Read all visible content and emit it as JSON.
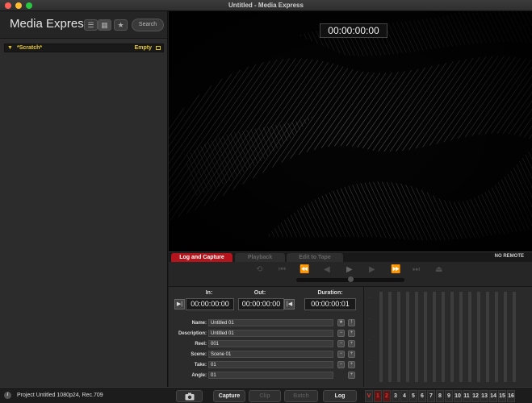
{
  "window": {
    "title": "Untitled - Media Express",
    "light_colors": [
      "#fe5f57",
      "#febc2e",
      "#28c840"
    ]
  },
  "sidebar": {
    "app_title": "Media Express",
    "list_view_icon": "list-icon",
    "thumbnail_view_icon": "grid-icon",
    "favorites_icon": "star-icon",
    "search_label": "Search",
    "bin": {
      "name": "*Scratch*",
      "status": "Empty"
    }
  },
  "viewer": {
    "timecode": "00:00:00:00"
  },
  "tabs": [
    {
      "label": "Log and Capture",
      "active": true
    },
    {
      "label": "Playback",
      "active": false
    },
    {
      "label": "Edit to Tape",
      "active": false
    }
  ],
  "remote_status": "NO REMOTE",
  "log": {
    "in_label": "In:",
    "out_label": "Out:",
    "duration_label": "Duration:",
    "in_tc": "00:00:00:00",
    "out_tc": "00:00:00:00",
    "duration_tc": "00:00:00:01",
    "fields": [
      {
        "label": "Name:",
        "value": "Untitled 01"
      },
      {
        "label": "Description:",
        "value": "Untitled 01"
      },
      {
        "label": "Reel:",
        "value": "001"
      },
      {
        "label": "Scene:",
        "value": "Scene 01"
      },
      {
        "label": "Take:",
        "value": "01"
      },
      {
        "label": "Angle:",
        "value": "01"
      }
    ]
  },
  "bottom": {
    "project_info": "Project Untitled  1080p24, Rec.709",
    "capture_label": "Capture",
    "clip_label": "Clip",
    "batch_label": "Batch",
    "log_label": "Log",
    "channels": [
      "V",
      "1",
      "2",
      "3",
      "4",
      "5",
      "6",
      "7",
      "8",
      "9",
      "10",
      "11",
      "12",
      "13",
      "14",
      "15",
      "16"
    ]
  },
  "colors": {
    "accent": "#b4141c",
    "bin_text": "#e8c830"
  }
}
